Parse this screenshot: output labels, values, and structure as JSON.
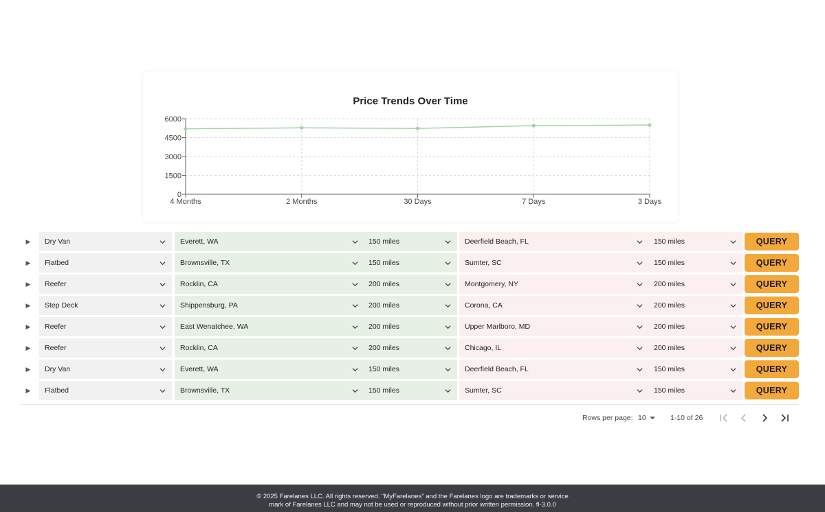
{
  "chart_data": {
    "type": "line",
    "title": "Price Trends Over Time",
    "categories": [
      "4 Months",
      "2 Months",
      "30 Days",
      "7 Days",
      "3 Days"
    ],
    "series": [
      {
        "values": [
          5200,
          5280,
          5230,
          5450,
          5500
        ]
      }
    ],
    "ylim": [
      0,
      6000
    ],
    "yticks": [
      "0",
      "1500",
      "3000",
      "4500",
      "6000"
    ],
    "grid": true,
    "color": "#9fd5a3"
  },
  "rows": [
    {
      "equipment": "Dry Van",
      "origin": "Everett, WA",
      "origin_radius": "150 miles",
      "destination": "Deerfield Beach, FL",
      "dest_radius": "150 miles",
      "action": "QUERY"
    },
    {
      "equipment": "Flatbed",
      "origin": "Brownsville, TX",
      "origin_radius": "150 miles",
      "destination": "Sumter, SC",
      "dest_radius": "150 miles",
      "action": "QUERY"
    },
    {
      "equipment": "Reefer",
      "origin": "Rocklin, CA",
      "origin_radius": "200 miles",
      "destination": "Montgomery, NY",
      "dest_radius": "200 miles",
      "action": "QUERY"
    },
    {
      "equipment": "Step Deck",
      "origin": "Shippensburg, PA",
      "origin_radius": "200 miles",
      "destination": "Corona, CA",
      "dest_radius": "200 miles",
      "action": "QUERY"
    },
    {
      "equipment": "Reefer",
      "origin": "East Wenatchee, WA",
      "origin_radius": "200 miles",
      "destination": "Upper Marlboro, MD",
      "dest_radius": "200 miles",
      "action": "QUERY"
    },
    {
      "equipment": "Reefer",
      "origin": "Rocklin, CA",
      "origin_radius": "200 miles",
      "destination": "Chicago, IL",
      "dest_radius": "200 miles",
      "action": "QUERY"
    },
    {
      "equipment": "Dry Van",
      "origin": "Everett, WA",
      "origin_radius": "150 miles",
      "destination": "Deerfield Beach, FL",
      "dest_radius": "150 miles",
      "action": "QUERY"
    },
    {
      "equipment": "Flatbed",
      "origin": "Brownsville, TX",
      "origin_radius": "150 miles",
      "destination": "Sumter, SC",
      "dest_radius": "150 miles",
      "action": "QUERY"
    }
  ],
  "pagination": {
    "rows_per_page_label": "Rows per page:",
    "rows_per_page_value": "10",
    "range": "1-10 of 26"
  },
  "icons": {
    "expand": "expand-arrow-icon",
    "dropdown": "chevron-down-icon",
    "first": "first-page-icon",
    "prev": "previous-page-icon",
    "next": "next-page-icon",
    "last": "last-page-icon"
  },
  "colors": {
    "query_button": "#f3a83b",
    "origin_cell": "#e7f0e5",
    "destination_cell": "#fcefef",
    "equipment_cell": "#f1f1f1",
    "footer_bg": "#3a3e43"
  },
  "footer": {
    "line1": "© 2025 Farelanes LLC. All rights reserved. \"MyFarelanes\" and the Farelanes logo are trademarks or service",
    "line2": "mark of Farelanes LLC and may not be used or reproduced without prior written permission.  fl-3.0.0"
  }
}
